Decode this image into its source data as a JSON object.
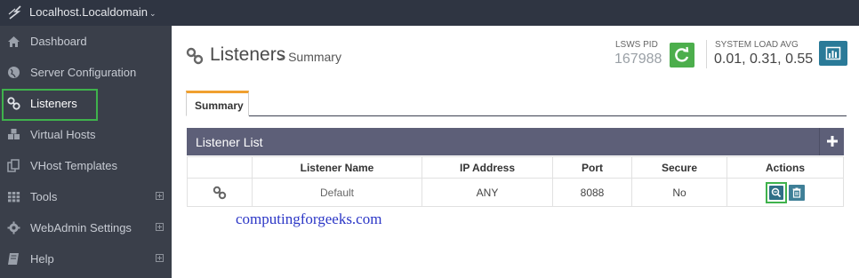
{
  "topbar": {
    "host": "Localhost.Localdomain"
  },
  "sidebar": {
    "items": [
      {
        "label": "Dashboard",
        "icon": "home-icon",
        "expandable": false
      },
      {
        "label": "Server Configuration",
        "icon": "globe-icon",
        "expandable": false
      },
      {
        "label": "Listeners",
        "icon": "link-icon",
        "expandable": false,
        "active": true
      },
      {
        "label": "Virtual Hosts",
        "icon": "cubes-icon",
        "expandable": false
      },
      {
        "label": "VHost Templates",
        "icon": "copy-icon",
        "expandable": false
      },
      {
        "label": "Tools",
        "icon": "grid-icon",
        "expandable": true
      },
      {
        "label": "WebAdmin Settings",
        "icon": "gear-icon",
        "expandable": true
      },
      {
        "label": "Help",
        "icon": "book-icon",
        "expandable": true
      }
    ]
  },
  "header": {
    "title": "Listeners",
    "subtitle": "> Summary",
    "pid_label": "LSWS PID",
    "pid_value": "167988",
    "load_label": "SYSTEM LOAD AVG",
    "load_value": "0.01, 0.31, 0.55"
  },
  "tabs": [
    {
      "label": "Summary"
    }
  ],
  "panel": {
    "title": "Listener List",
    "columns": [
      "",
      "Listener Name",
      "IP Address",
      "Port",
      "Secure",
      "Actions"
    ],
    "rows": [
      {
        "name": "Default",
        "ip": "ANY",
        "port": "8088",
        "secure": "No"
      }
    ]
  },
  "watermark": "computingforgeeks.com",
  "colors": {
    "accent_green": "#3fb24c",
    "sidebar_bg": "#3a3f4a",
    "panel_header": "#5d5f78",
    "tab_accent": "#f0a030"
  }
}
